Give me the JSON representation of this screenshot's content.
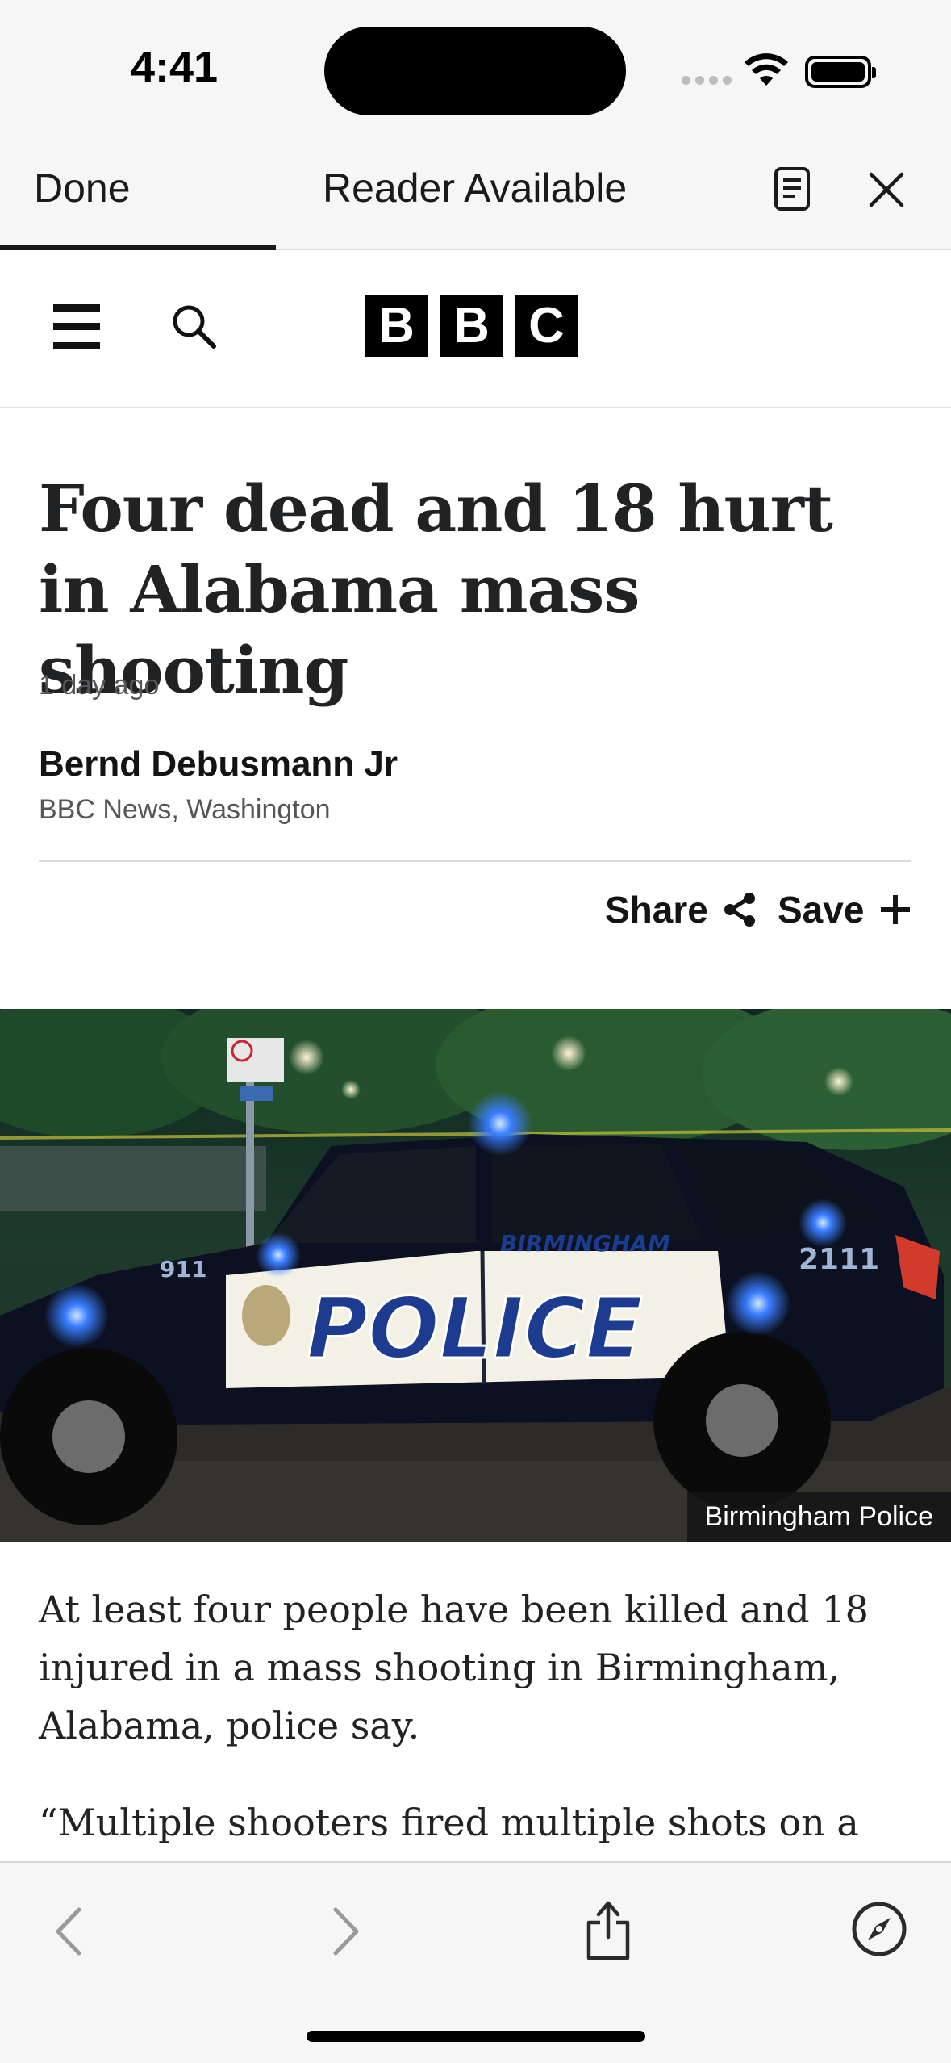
{
  "status_bar": {
    "time": "4:41"
  },
  "safari_bar": {
    "done_label": "Done",
    "reader_label": "Reader Available",
    "page_load_progress": 0.29
  },
  "bbc": {
    "logo_letters": [
      "B",
      "B",
      "C"
    ]
  },
  "article": {
    "headline": "Four dead and 18 hurt in Alabama mass shooting",
    "timestamp": "1 day ago",
    "author": "Bernd Debusmann Jr",
    "author_location": "BBC News, Washington",
    "share_label": "Share",
    "save_label": "Save",
    "image_caption": "Birmingham Police",
    "image_text": {
      "car_text": "POLICE",
      "car_city": "BIRMINGHAM",
      "car_number": "2111",
      "car_911": "911"
    },
    "paragraph_1": "At least four people have been killed and 18 injured in a mass shooting in Birmingham, Alabama, police say.",
    "paragraph_2": "“Multiple shooters fired multiple shots on a"
  },
  "colors": {
    "accent": "#1a1a1a",
    "toolbar_bg": "#f6f6f6",
    "headline": "#202224"
  }
}
